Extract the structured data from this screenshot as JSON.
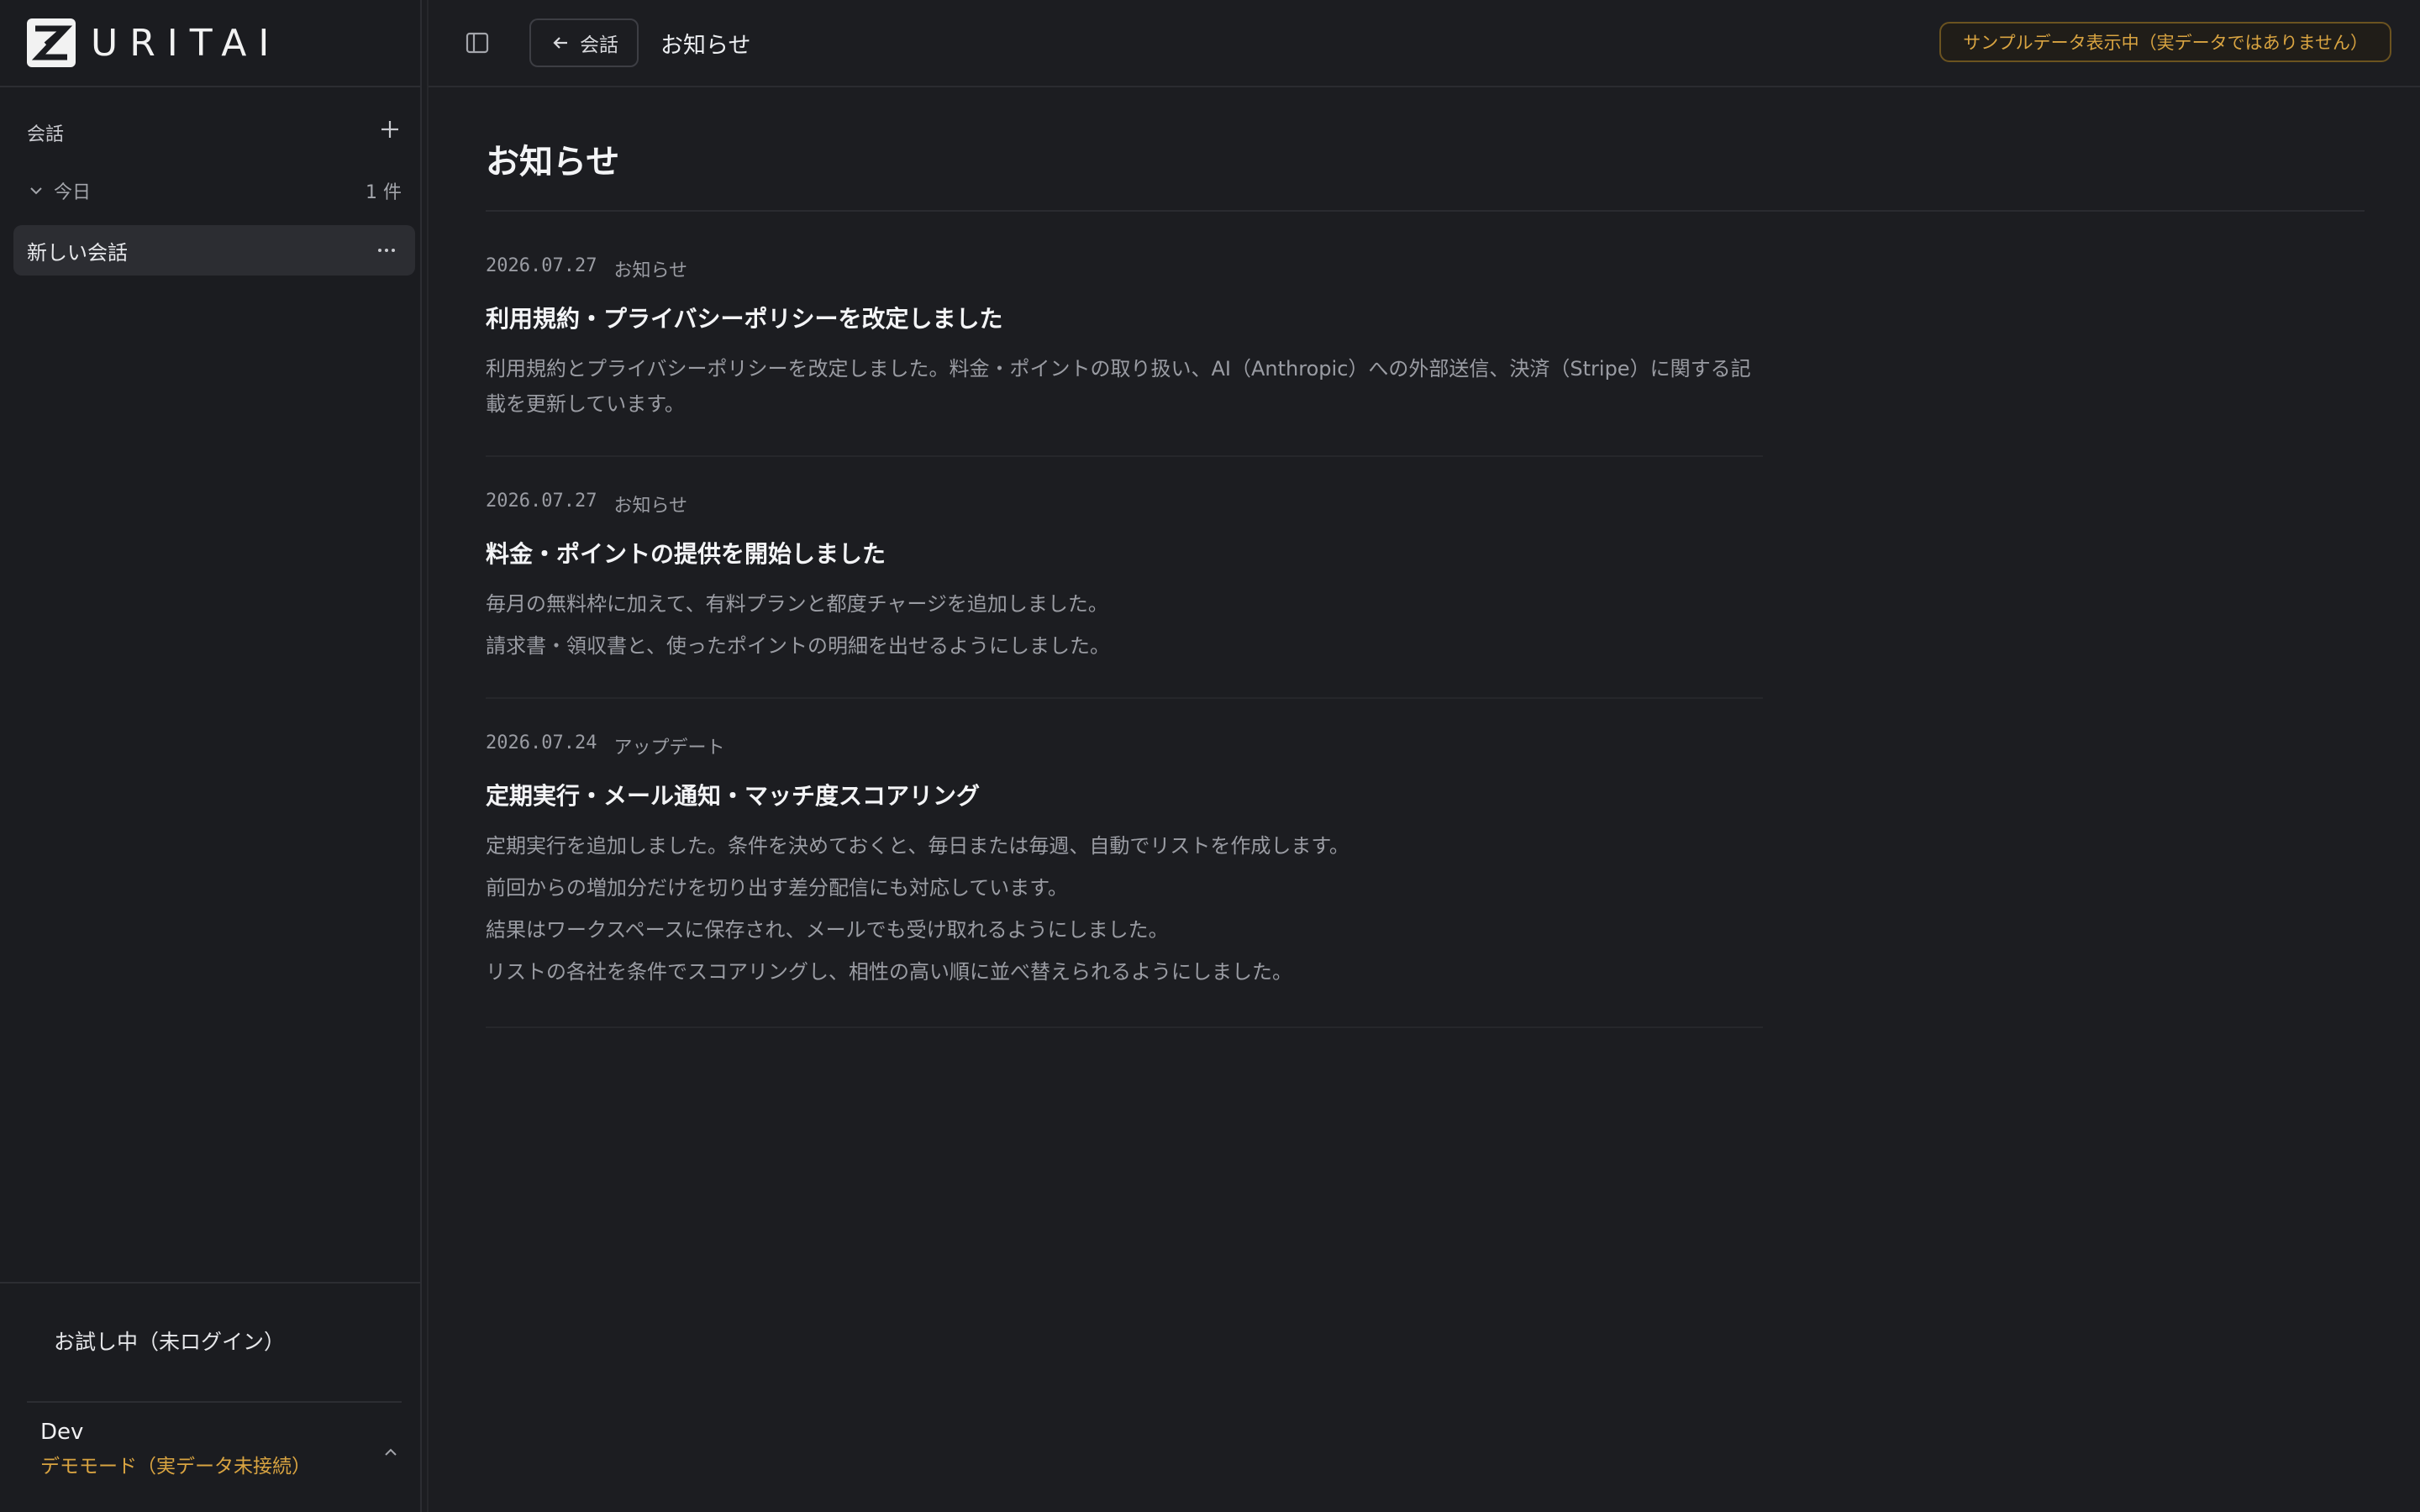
{
  "brand": {
    "name": "URITAI"
  },
  "sidebar": {
    "section_label": "会話",
    "group": {
      "label": "今日",
      "count": "1 件"
    },
    "conversations": [
      {
        "label": "新しい会話"
      }
    ],
    "trial_status": "お試し中（未ログイン）",
    "user": {
      "name": "Dev",
      "mode": "デモモード（実データ未接続）"
    }
  },
  "topbar": {
    "back_label": "会話",
    "breadcrumb": "お知らせ",
    "sample_notice": "サンプルデータ表示中（実データではありません）"
  },
  "main": {
    "title": "お知らせ",
    "news": [
      {
        "date": "2026.07.27",
        "category": "お知らせ",
        "title": "利用規約・プライバシーポリシーを改定しました",
        "body": [
          "利用規約とプライバシーポリシーを改定しました。料金・ポイントの取り扱い、AI（Anthropic）への外部送信、決済（Stripe）に関する記載を更新しています。"
        ]
      },
      {
        "date": "2026.07.27",
        "category": "お知らせ",
        "title": "料金・ポイントの提供を開始しました",
        "body": [
          "毎月の無料枠に加えて、有料プランと都度チャージを追加しました。",
          "請求書・領収書と、使ったポイントの明細を出せるようにしました。"
        ]
      },
      {
        "date": "2026.07.24",
        "category": "アップデート",
        "title": "定期実行・メール通知・マッチ度スコアリング",
        "body": [
          "定期実行を追加しました。条件を決めておくと、毎日または毎週、自動でリストを作成します。",
          "前回からの増加分だけを切り出す差分配信にも対応しています。",
          "結果はワークスペースに保存され、メールでも受け取れるようにしました。",
          "リストの各社を条件でスコアリングし、相性の高い順に並べ替えられるようにしました。"
        ]
      }
    ]
  },
  "colors": {
    "background": "#1c1d21",
    "accent_warning": "#d9a441",
    "selected_item": "#2c2d32"
  }
}
